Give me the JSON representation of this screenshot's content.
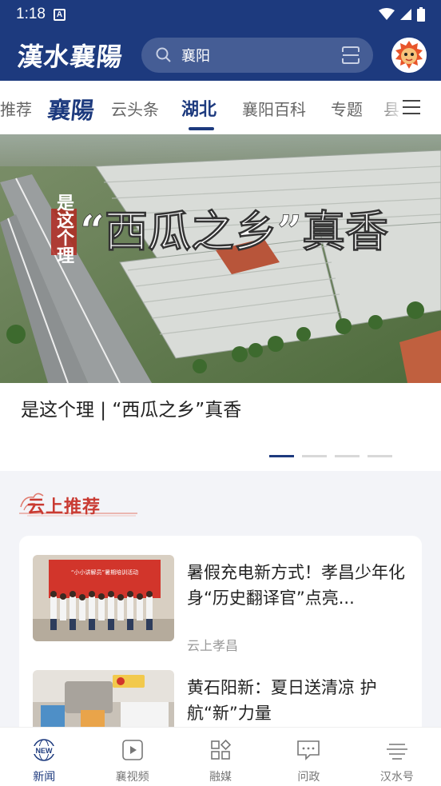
{
  "status_bar": {
    "time": "1:18",
    "notification_badge": "A"
  },
  "header": {
    "logo": "漢水襄陽",
    "search_text": "襄阳",
    "search_icon": "search-icon",
    "scan_icon": "scan-icon"
  },
  "tabs": [
    {
      "label": "推荐"
    },
    {
      "label": "襄陽"
    },
    {
      "label": "云头条"
    },
    {
      "label": "湖北"
    },
    {
      "label": "襄阳百科"
    },
    {
      "label": "专题"
    },
    {
      "label": "县"
    }
  ],
  "active_tab": "湖北",
  "hero": {
    "title": "是这个理 | “西瓜之乡”真香",
    "overlay_main": "“西瓜之乡”真香",
    "overlay_side": "是这个理",
    "slide_count": 4,
    "active_slide": 1
  },
  "section": {
    "title": "云上推荐"
  },
  "articles": [
    {
      "title": "暑假充电新方式！孝昌少年化身“历史翻译官”点亮...",
      "source": "云上孝昌",
      "banner_text": "“小小讲解员”暑期培训活动"
    },
    {
      "title": "黄石阳新：夏日送清凉 护航“新”力量",
      "source": ""
    }
  ],
  "bottom_nav": [
    {
      "label": "新闻",
      "icon": "globe-news-icon",
      "active": true,
      "badge": "NEW"
    },
    {
      "label": "襄视频",
      "icon": "play-icon",
      "active": false
    },
    {
      "label": "融媒",
      "icon": "grid-icon",
      "active": false
    },
    {
      "label": "问政",
      "icon": "chat-icon",
      "active": false
    },
    {
      "label": "汉水号",
      "icon": "lines-icon",
      "active": false
    }
  ],
  "colors": {
    "brand": "#1d3a7e",
    "section_accent": "#c93a32"
  }
}
